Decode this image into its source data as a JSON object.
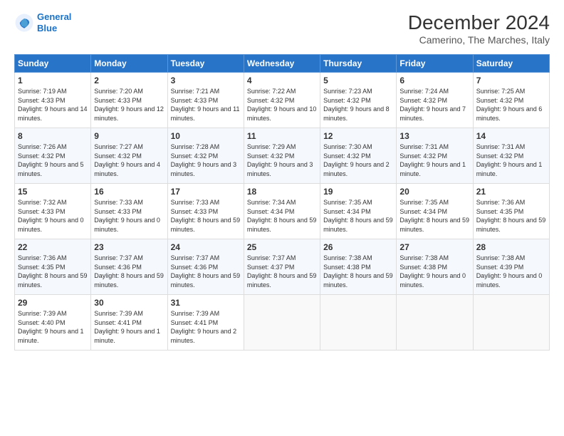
{
  "logo": {
    "line1": "General",
    "line2": "Blue"
  },
  "title": "December 2024",
  "subtitle": "Camerino, The Marches, Italy",
  "days_of_week": [
    "Sunday",
    "Monday",
    "Tuesday",
    "Wednesday",
    "Thursday",
    "Friday",
    "Saturday"
  ],
  "weeks": [
    [
      {
        "day": "1",
        "sunrise": "7:19 AM",
        "sunset": "4:33 PM",
        "daylight": "9 hours and 14 minutes."
      },
      {
        "day": "2",
        "sunrise": "7:20 AM",
        "sunset": "4:33 PM",
        "daylight": "9 hours and 12 minutes."
      },
      {
        "day": "3",
        "sunrise": "7:21 AM",
        "sunset": "4:33 PM",
        "daylight": "9 hours and 11 minutes."
      },
      {
        "day": "4",
        "sunrise": "7:22 AM",
        "sunset": "4:32 PM",
        "daylight": "9 hours and 10 minutes."
      },
      {
        "day": "5",
        "sunrise": "7:23 AM",
        "sunset": "4:32 PM",
        "daylight": "9 hours and 8 minutes."
      },
      {
        "day": "6",
        "sunrise": "7:24 AM",
        "sunset": "4:32 PM",
        "daylight": "9 hours and 7 minutes."
      },
      {
        "day": "7",
        "sunrise": "7:25 AM",
        "sunset": "4:32 PM",
        "daylight": "9 hours and 6 minutes."
      }
    ],
    [
      {
        "day": "8",
        "sunrise": "7:26 AM",
        "sunset": "4:32 PM",
        "daylight": "9 hours and 5 minutes."
      },
      {
        "day": "9",
        "sunrise": "7:27 AM",
        "sunset": "4:32 PM",
        "daylight": "9 hours and 4 minutes."
      },
      {
        "day": "10",
        "sunrise": "7:28 AM",
        "sunset": "4:32 PM",
        "daylight": "9 hours and 3 minutes."
      },
      {
        "day": "11",
        "sunrise": "7:29 AM",
        "sunset": "4:32 PM",
        "daylight": "9 hours and 3 minutes."
      },
      {
        "day": "12",
        "sunrise": "7:30 AM",
        "sunset": "4:32 PM",
        "daylight": "9 hours and 2 minutes."
      },
      {
        "day": "13",
        "sunrise": "7:31 AM",
        "sunset": "4:32 PM",
        "daylight": "9 hours and 1 minute."
      },
      {
        "day": "14",
        "sunrise": "7:31 AM",
        "sunset": "4:32 PM",
        "daylight": "9 hours and 1 minute."
      }
    ],
    [
      {
        "day": "15",
        "sunrise": "7:32 AM",
        "sunset": "4:33 PM",
        "daylight": "9 hours and 0 minutes."
      },
      {
        "day": "16",
        "sunrise": "7:33 AM",
        "sunset": "4:33 PM",
        "daylight": "9 hours and 0 minutes."
      },
      {
        "day": "17",
        "sunrise": "7:33 AM",
        "sunset": "4:33 PM",
        "daylight": "8 hours and 59 minutes."
      },
      {
        "day": "18",
        "sunrise": "7:34 AM",
        "sunset": "4:34 PM",
        "daylight": "8 hours and 59 minutes."
      },
      {
        "day": "19",
        "sunrise": "7:35 AM",
        "sunset": "4:34 PM",
        "daylight": "8 hours and 59 minutes."
      },
      {
        "day": "20",
        "sunrise": "7:35 AM",
        "sunset": "4:34 PM",
        "daylight": "8 hours and 59 minutes."
      },
      {
        "day": "21",
        "sunrise": "7:36 AM",
        "sunset": "4:35 PM",
        "daylight": "8 hours and 59 minutes."
      }
    ],
    [
      {
        "day": "22",
        "sunrise": "7:36 AM",
        "sunset": "4:35 PM",
        "daylight": "8 hours and 59 minutes."
      },
      {
        "day": "23",
        "sunrise": "7:37 AM",
        "sunset": "4:36 PM",
        "daylight": "8 hours and 59 minutes."
      },
      {
        "day": "24",
        "sunrise": "7:37 AM",
        "sunset": "4:36 PM",
        "daylight": "8 hours and 59 minutes."
      },
      {
        "day": "25",
        "sunrise": "7:37 AM",
        "sunset": "4:37 PM",
        "daylight": "8 hours and 59 minutes."
      },
      {
        "day": "26",
        "sunrise": "7:38 AM",
        "sunset": "4:38 PM",
        "daylight": "8 hours and 59 minutes."
      },
      {
        "day": "27",
        "sunrise": "7:38 AM",
        "sunset": "4:38 PM",
        "daylight": "9 hours and 0 minutes."
      },
      {
        "day": "28",
        "sunrise": "7:38 AM",
        "sunset": "4:39 PM",
        "daylight": "9 hours and 0 minutes."
      }
    ],
    [
      {
        "day": "29",
        "sunrise": "7:39 AM",
        "sunset": "4:40 PM",
        "daylight": "9 hours and 1 minute."
      },
      {
        "day": "30",
        "sunrise": "7:39 AM",
        "sunset": "4:41 PM",
        "daylight": "9 hours and 1 minute."
      },
      {
        "day": "31",
        "sunrise": "7:39 AM",
        "sunset": "4:41 PM",
        "daylight": "9 hours and 2 minutes."
      },
      null,
      null,
      null,
      null
    ]
  ]
}
